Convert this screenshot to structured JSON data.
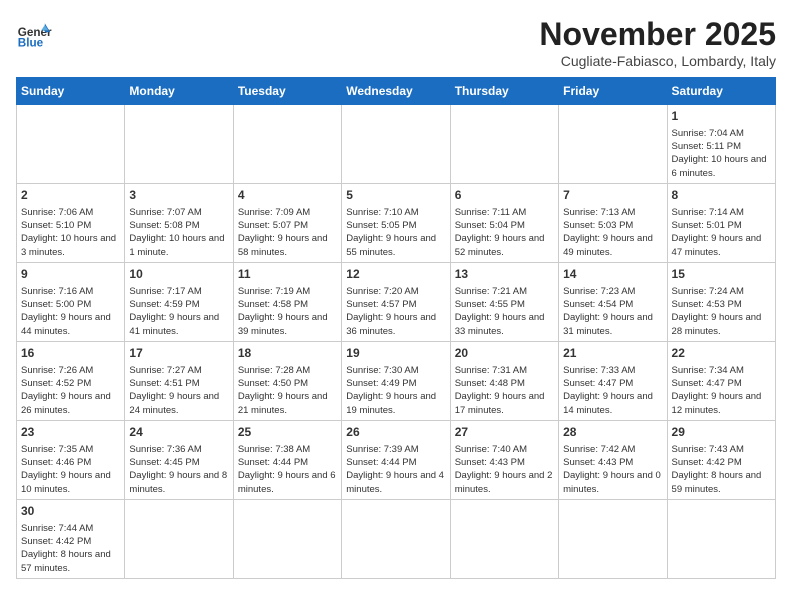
{
  "header": {
    "logo_general": "General",
    "logo_blue": "Blue",
    "month_title": "November 2025",
    "location": "Cugliate-Fabiasco, Lombardy, Italy"
  },
  "days_of_week": [
    "Sunday",
    "Monday",
    "Tuesday",
    "Wednesday",
    "Thursday",
    "Friday",
    "Saturday"
  ],
  "weeks": [
    [
      null,
      null,
      null,
      null,
      null,
      null,
      {
        "day": 1,
        "sunrise": "7:04 AM",
        "sunset": "5:11 PM",
        "daylight": "10 hours and 6 minutes."
      }
    ],
    [
      {
        "day": 2,
        "sunrise": "7:06 AM",
        "sunset": "5:10 PM",
        "daylight": "10 hours and 3 minutes."
      },
      {
        "day": 3,
        "sunrise": "7:07 AM",
        "sunset": "5:08 PM",
        "daylight": "10 hours and 1 minute."
      },
      {
        "day": 4,
        "sunrise": "7:09 AM",
        "sunset": "5:07 PM",
        "daylight": "9 hours and 58 minutes."
      },
      {
        "day": 5,
        "sunrise": "7:10 AM",
        "sunset": "5:05 PM",
        "daylight": "9 hours and 55 minutes."
      },
      {
        "day": 6,
        "sunrise": "7:11 AM",
        "sunset": "5:04 PM",
        "daylight": "9 hours and 52 minutes."
      },
      {
        "day": 7,
        "sunrise": "7:13 AM",
        "sunset": "5:03 PM",
        "daylight": "9 hours and 49 minutes."
      },
      {
        "day": 8,
        "sunrise": "7:14 AM",
        "sunset": "5:01 PM",
        "daylight": "9 hours and 47 minutes."
      }
    ],
    [
      {
        "day": 9,
        "sunrise": "7:16 AM",
        "sunset": "5:00 PM",
        "daylight": "9 hours and 44 minutes."
      },
      {
        "day": 10,
        "sunrise": "7:17 AM",
        "sunset": "4:59 PM",
        "daylight": "9 hours and 41 minutes."
      },
      {
        "day": 11,
        "sunrise": "7:19 AM",
        "sunset": "4:58 PM",
        "daylight": "9 hours and 39 minutes."
      },
      {
        "day": 12,
        "sunrise": "7:20 AM",
        "sunset": "4:57 PM",
        "daylight": "9 hours and 36 minutes."
      },
      {
        "day": 13,
        "sunrise": "7:21 AM",
        "sunset": "4:55 PM",
        "daylight": "9 hours and 33 minutes."
      },
      {
        "day": 14,
        "sunrise": "7:23 AM",
        "sunset": "4:54 PM",
        "daylight": "9 hours and 31 minutes."
      },
      {
        "day": 15,
        "sunrise": "7:24 AM",
        "sunset": "4:53 PM",
        "daylight": "9 hours and 28 minutes."
      }
    ],
    [
      {
        "day": 16,
        "sunrise": "7:26 AM",
        "sunset": "4:52 PM",
        "daylight": "9 hours and 26 minutes."
      },
      {
        "day": 17,
        "sunrise": "7:27 AM",
        "sunset": "4:51 PM",
        "daylight": "9 hours and 24 minutes."
      },
      {
        "day": 18,
        "sunrise": "7:28 AM",
        "sunset": "4:50 PM",
        "daylight": "9 hours and 21 minutes."
      },
      {
        "day": 19,
        "sunrise": "7:30 AM",
        "sunset": "4:49 PM",
        "daylight": "9 hours and 19 minutes."
      },
      {
        "day": 20,
        "sunrise": "7:31 AM",
        "sunset": "4:48 PM",
        "daylight": "9 hours and 17 minutes."
      },
      {
        "day": 21,
        "sunrise": "7:33 AM",
        "sunset": "4:47 PM",
        "daylight": "9 hours and 14 minutes."
      },
      {
        "day": 22,
        "sunrise": "7:34 AM",
        "sunset": "4:47 PM",
        "daylight": "9 hours and 12 minutes."
      }
    ],
    [
      {
        "day": 23,
        "sunrise": "7:35 AM",
        "sunset": "4:46 PM",
        "daylight": "9 hours and 10 minutes."
      },
      {
        "day": 24,
        "sunrise": "7:36 AM",
        "sunset": "4:45 PM",
        "daylight": "9 hours and 8 minutes."
      },
      {
        "day": 25,
        "sunrise": "7:38 AM",
        "sunset": "4:44 PM",
        "daylight": "9 hours and 6 minutes."
      },
      {
        "day": 26,
        "sunrise": "7:39 AM",
        "sunset": "4:44 PM",
        "daylight": "9 hours and 4 minutes."
      },
      {
        "day": 27,
        "sunrise": "7:40 AM",
        "sunset": "4:43 PM",
        "daylight": "9 hours and 2 minutes."
      },
      {
        "day": 28,
        "sunrise": "7:42 AM",
        "sunset": "4:43 PM",
        "daylight": "9 hours and 0 minutes."
      },
      {
        "day": 29,
        "sunrise": "7:43 AM",
        "sunset": "4:42 PM",
        "daylight": "8 hours and 59 minutes."
      }
    ],
    [
      {
        "day": 30,
        "sunrise": "7:44 AM",
        "sunset": "4:42 PM",
        "daylight": "8 hours and 57 minutes."
      },
      null,
      null,
      null,
      null,
      null,
      null
    ]
  ]
}
